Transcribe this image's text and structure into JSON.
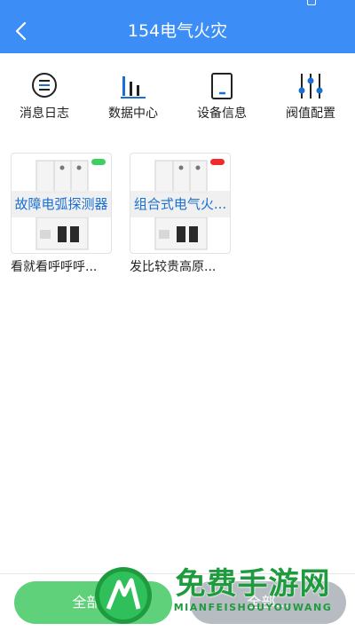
{
  "header": {
    "title": "154电气火灾"
  },
  "nav": {
    "items": [
      {
        "label": "消息日志",
        "icon": "message-log-icon"
      },
      {
        "label": "数据中心",
        "icon": "bar-chart-icon"
      },
      {
        "label": "设备信息",
        "icon": "device-info-icon"
      },
      {
        "label": "阀值配置",
        "icon": "sliders-icon"
      }
    ]
  },
  "devices": [
    {
      "name": "故障电弧探测器",
      "description": "看就看呼呼呼...",
      "status_color": "#3ecf5e"
    },
    {
      "name": "组合式电气火...",
      "description": "发比较贵高原...",
      "status_color": "#ef2b2b"
    }
  ],
  "actions": {
    "left_label": "全部...",
    "right_label": "全部..."
  },
  "watermark": {
    "text": "免费手游网",
    "subtext": "MIANFEISHOUYOUWANG"
  },
  "colors": {
    "primary": "#3c8ef6",
    "icon_blue": "#1a6fd3",
    "status_online": "#3ecf5e",
    "status_alarm": "#ef2b2b"
  }
}
